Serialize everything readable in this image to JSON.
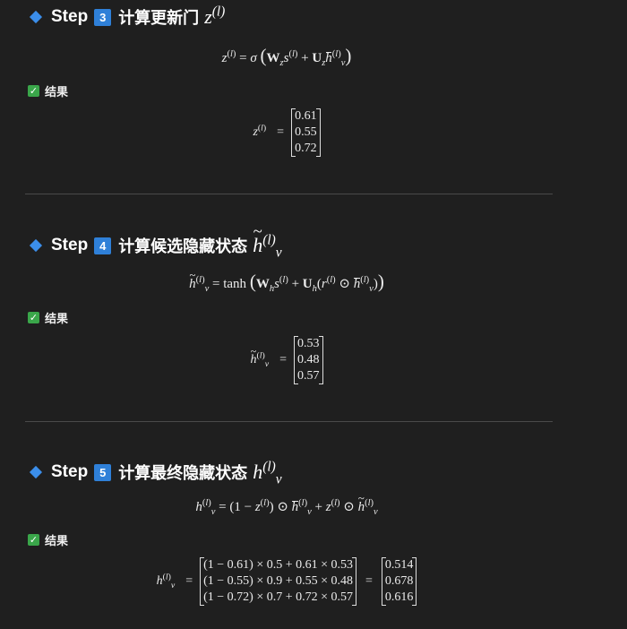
{
  "steps": [
    {
      "label": "Step",
      "number": "3",
      "title": "计算更新门",
      "result_label": "结果",
      "result_values": [
        "0.61",
        "0.55",
        "0.72"
      ]
    },
    {
      "label": "Step",
      "number": "4",
      "title": "计算候选隐藏状态",
      "result_label": "结果",
      "result_values": [
        "0.53",
        "0.48",
        "0.57"
      ]
    },
    {
      "label": "Step",
      "number": "5",
      "title": "计算最终隐藏状态",
      "result_label": "结果",
      "result_terms": [
        "(1 − 0.61) × 0.5 + 0.61 × 0.53",
        "(1 − 0.55) × 0.9 + 0.55 × 0.48",
        "(1 − 0.72) × 0.7 + 0.72 × 0.57"
      ],
      "result_values": [
        "0.514",
        "0.678",
        "0.616"
      ]
    }
  ],
  "colors": {
    "background": "#1f1f1f",
    "accent": "#3b8eea",
    "badge": "#2f80d8",
    "check": "#3aa64a",
    "divider": "#4a4a4a"
  },
  "icons": {
    "step_marker": "diamond-icon",
    "result_marker": "checkmark-icon"
  }
}
